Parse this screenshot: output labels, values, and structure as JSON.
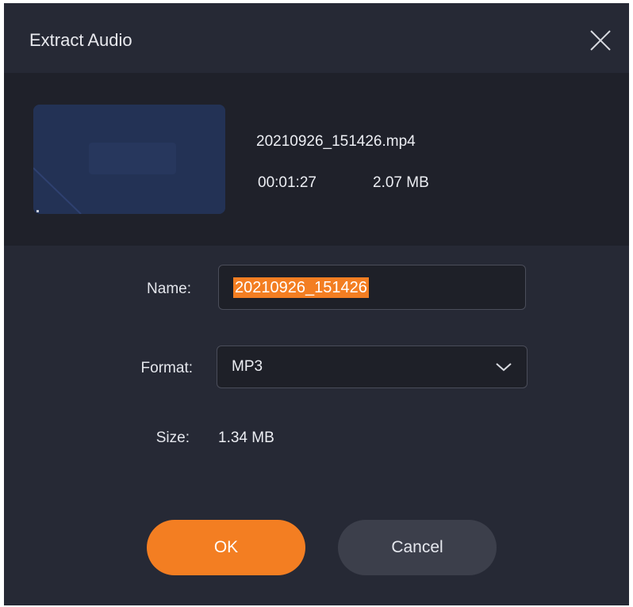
{
  "dialog": {
    "title": "Extract Audio",
    "close_icon": "close-icon"
  },
  "file": {
    "thumbnail_icon": "video-thumbnail",
    "name": "20210926_151426.mp4",
    "duration": "00:01:27",
    "size": "2.07 MB"
  },
  "form": {
    "name_label": "Name:",
    "name_value": "20210926_151426",
    "format_label": "Format:",
    "format_value": "MP3",
    "format_icon": "chevron-down-icon",
    "size_label": "Size:",
    "size_value": "1.34 MB"
  },
  "buttons": {
    "ok": "OK",
    "cancel": "Cancel"
  },
  "colors": {
    "accent": "#f37e22",
    "background": "#262935",
    "panel": "#1f212a"
  }
}
